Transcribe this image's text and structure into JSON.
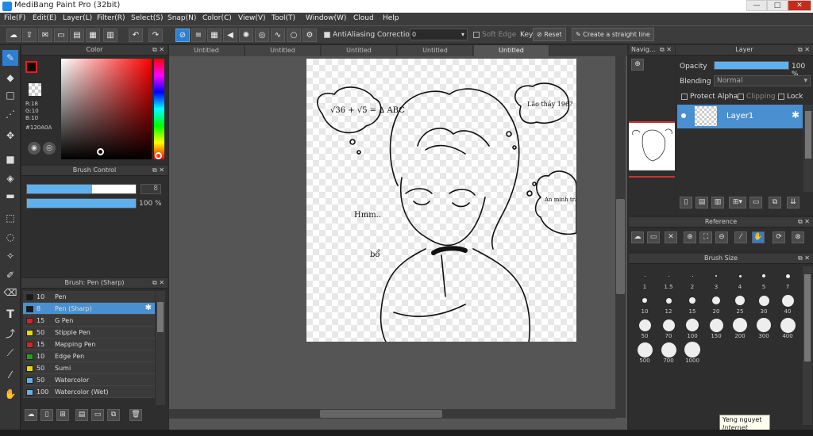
{
  "window": {
    "title": "MediBang Paint Pro (32bit)",
    "minimize": "—",
    "maximize": "□",
    "close": "✕"
  },
  "menu": [
    "File(F)",
    "Edit(E)",
    "Layer(L)",
    "Filter(R)",
    "Select(S)",
    "Snap(N)",
    "Color(C)",
    "View(V)",
    "Tool(T)",
    "Window(W)",
    "Cloud",
    "Help"
  ],
  "toolbar": {
    "antialiasing": "AntiAliasing",
    "correction_label": "Correction",
    "correction_value": "0",
    "soft_edge": "Soft Edge",
    "key": "Key",
    "reset": "Reset",
    "straight_line": "Create a straight line"
  },
  "color_panel": {
    "title": "Color",
    "r": "R:18",
    "g": "G:10",
    "b": "B:10",
    "hex": "#120A0A",
    "accent": "#120A0A"
  },
  "brush_control": {
    "title": "Brush Control",
    "size_value": "8",
    "opacity_value": "100 %",
    "size_fill": 0.6,
    "opacity_fill": 1.0
  },
  "brush_list": {
    "title": "Brush: Pen (Sharp)",
    "items": [
      {
        "size": "10",
        "name": "Pen",
        "color": "#1a1a1a"
      },
      {
        "size": "8",
        "name": "Pen (Sharp)",
        "color": "#1a1a1a"
      },
      {
        "size": "15",
        "name": "G Pen",
        "color": "#e02020"
      },
      {
        "size": "50",
        "name": "Stipple Pen",
        "color": "#e8d800"
      },
      {
        "size": "15",
        "name": "Mapping Pen",
        "color": "#e02020"
      },
      {
        "size": "10",
        "name": "Edge Pen",
        "color": "#20a020"
      },
      {
        "size": "50",
        "name": "Sumi",
        "color": "#e8d800"
      },
      {
        "size": "50",
        "name": "Watercolor",
        "color": "#5fb1ee"
      },
      {
        "size": "100",
        "name": "Watercolor (Wet)",
        "color": "#5fb1ee"
      }
    ]
  },
  "doc_tabs": [
    "Untitled",
    "Untitled",
    "Untitled",
    "Untitled",
    "Untitled"
  ],
  "canvas_text": {
    "top_left_bubble": "√36 + √5 = ∆ ABC",
    "top_right_bubble": "Lão thầy 196?",
    "right_bubble": "An mình trật bé",
    "left_note": "Hmm..",
    "small_note": "bổ"
  },
  "navigator": {
    "title": "Navig..."
  },
  "layer_panel": {
    "title": "Layer",
    "opacity_label": "Opacity",
    "opacity_value": "100 %",
    "opacity_fill": 1.0,
    "blending_label": "Blending",
    "blending_value": "Normal",
    "protect_alpha": "Protect Alpha",
    "clipping": "Clipping",
    "lock": "Lock",
    "layer_name": "Layer1"
  },
  "reference": {
    "title": "Reference"
  },
  "brush_size": {
    "title": "Brush Size",
    "sizes": [
      "1",
      "1.5",
      "2",
      "3",
      "4",
      "5",
      "7",
      "10",
      "12",
      "15",
      "20",
      "25",
      "30",
      "40",
      "50",
      "70",
      "100",
      "150",
      "200",
      "300",
      "400",
      "500",
      "700",
      "1000"
    ]
  },
  "tooltip": {
    "name": "Yeng nguyet",
    "zone": "Internet access"
  }
}
